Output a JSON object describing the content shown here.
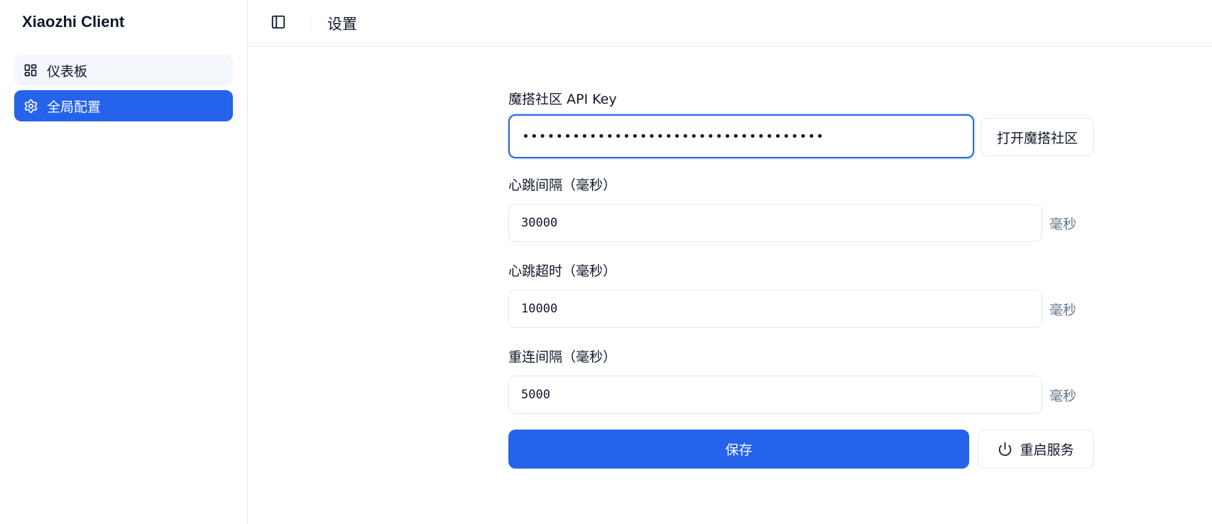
{
  "sidebar": {
    "brand": "Xiaozhi Client",
    "items": [
      {
        "label": "仪表板",
        "icon": "dashboard-icon",
        "active": false
      },
      {
        "label": "全局配置",
        "icon": "gear-icon",
        "active": true
      }
    ]
  },
  "header": {
    "title": "设置",
    "toggle_icon": "sidebar-toggle-icon"
  },
  "form": {
    "api_key": {
      "label": "魔搭社区 API Key",
      "value": "••••••••••••••••••••••••••••••••••••",
      "button_label": "打开魔搭社区"
    },
    "heartbeat_interval": {
      "label": "心跳间隔（毫秒）",
      "value": "30000",
      "unit": "毫秒"
    },
    "heartbeat_timeout": {
      "label": "心跳超时（毫秒）",
      "value": "10000",
      "unit": "毫秒"
    },
    "reconnect_interval": {
      "label": "重连间隔（毫秒）",
      "value": "5000",
      "unit": "毫秒"
    },
    "save_label": "保存",
    "restart_label": "重启服务",
    "restart_icon": "power-icon"
  },
  "colors": {
    "accent": "#2563eb",
    "unit_text": "#64748b",
    "border": "#e2e8f0"
  }
}
